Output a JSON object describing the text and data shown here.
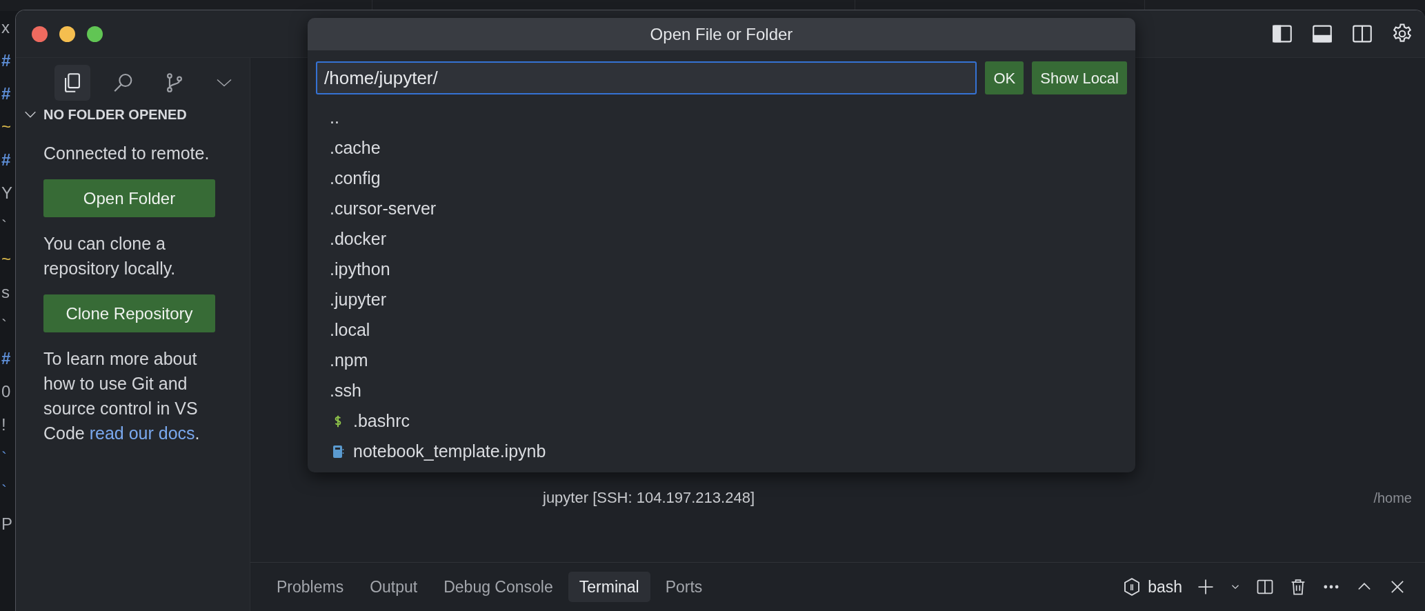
{
  "background_fragments": [
    {
      "text": "x",
      "kind": "plain"
    },
    {
      "text": "#",
      "kind": "heading"
    },
    {
      "text": "#",
      "kind": "heading"
    },
    {
      "text": "~",
      "kind": "warn"
    },
    {
      "text": "#",
      "kind": "heading"
    },
    {
      "text": "Y",
      "kind": "plain"
    },
    {
      "text": "`",
      "kind": "plain"
    },
    {
      "text": "~",
      "kind": "warn"
    },
    {
      "text": "s",
      "kind": "plain"
    },
    {
      "text": "`",
      "kind": "plain"
    },
    {
      "text": "#",
      "kind": "heading"
    },
    {
      "text": "0",
      "kind": "plain"
    },
    {
      "text": "!",
      "kind": "plain"
    },
    {
      "text": "`",
      "kind": "code"
    },
    {
      "text": "`",
      "kind": "code"
    },
    {
      "text": "P",
      "kind": "plain"
    }
  ],
  "activity_bar": [
    {
      "selected": true
    },
    {
      "selected": false
    },
    {
      "selected": false
    }
  ],
  "sidebar": {
    "section_title": "NO FOLDER OPENED",
    "expanded": true,
    "blocks": [
      {
        "kind": "text",
        "text": "Connected to remote."
      },
      {
        "kind": "button",
        "text": "Open Folder"
      },
      {
        "kind": "text",
        "text": "You can clone a repository locally."
      },
      {
        "kind": "button",
        "text": "Clone Repository"
      },
      {
        "kind": "text_link",
        "text": "To learn more about how to use Git and source control in VS Code",
        "link": "read our docs",
        "after": "."
      }
    ]
  },
  "layout_controls": [
    {
      "on": true
    },
    {
      "on": true
    },
    {
      "on": false
    }
  ],
  "dialog": {
    "title": "Open File or Folder",
    "value": "/home/jupyter/",
    "buttons": [
      "OK",
      "Show Local"
    ],
    "items": [
      {
        "name": "..",
        "kind": "folder"
      },
      {
        "name": ".cache",
        "kind": "folder"
      },
      {
        "name": ".config",
        "kind": "folder"
      },
      {
        "name": ".cursor-server",
        "kind": "folder"
      },
      {
        "name": ".docker",
        "kind": "folder"
      },
      {
        "name": ".ipython",
        "kind": "folder"
      },
      {
        "name": ".jupyter",
        "kind": "folder"
      },
      {
        "name": ".local",
        "kind": "folder"
      },
      {
        "name": ".npm",
        "kind": "folder"
      },
      {
        "name": ".ssh",
        "kind": "folder"
      },
      {
        "name": ".bashrc",
        "kind": "shell"
      },
      {
        "name": "notebook_template.ipynb",
        "kind": "notebook"
      }
    ]
  },
  "recent": {
    "name": "jupyter [SSH: 104.197.213.248]",
    "path": "/home"
  },
  "panel": {
    "tabs": [
      {
        "label": "Problems",
        "selected": false
      },
      {
        "label": "Output",
        "selected": false
      },
      {
        "label": "Debug Console",
        "selected": false
      },
      {
        "label": "Terminal",
        "selected": true
      },
      {
        "label": "Ports",
        "selected": false
      }
    ],
    "terminal": "bash"
  }
}
